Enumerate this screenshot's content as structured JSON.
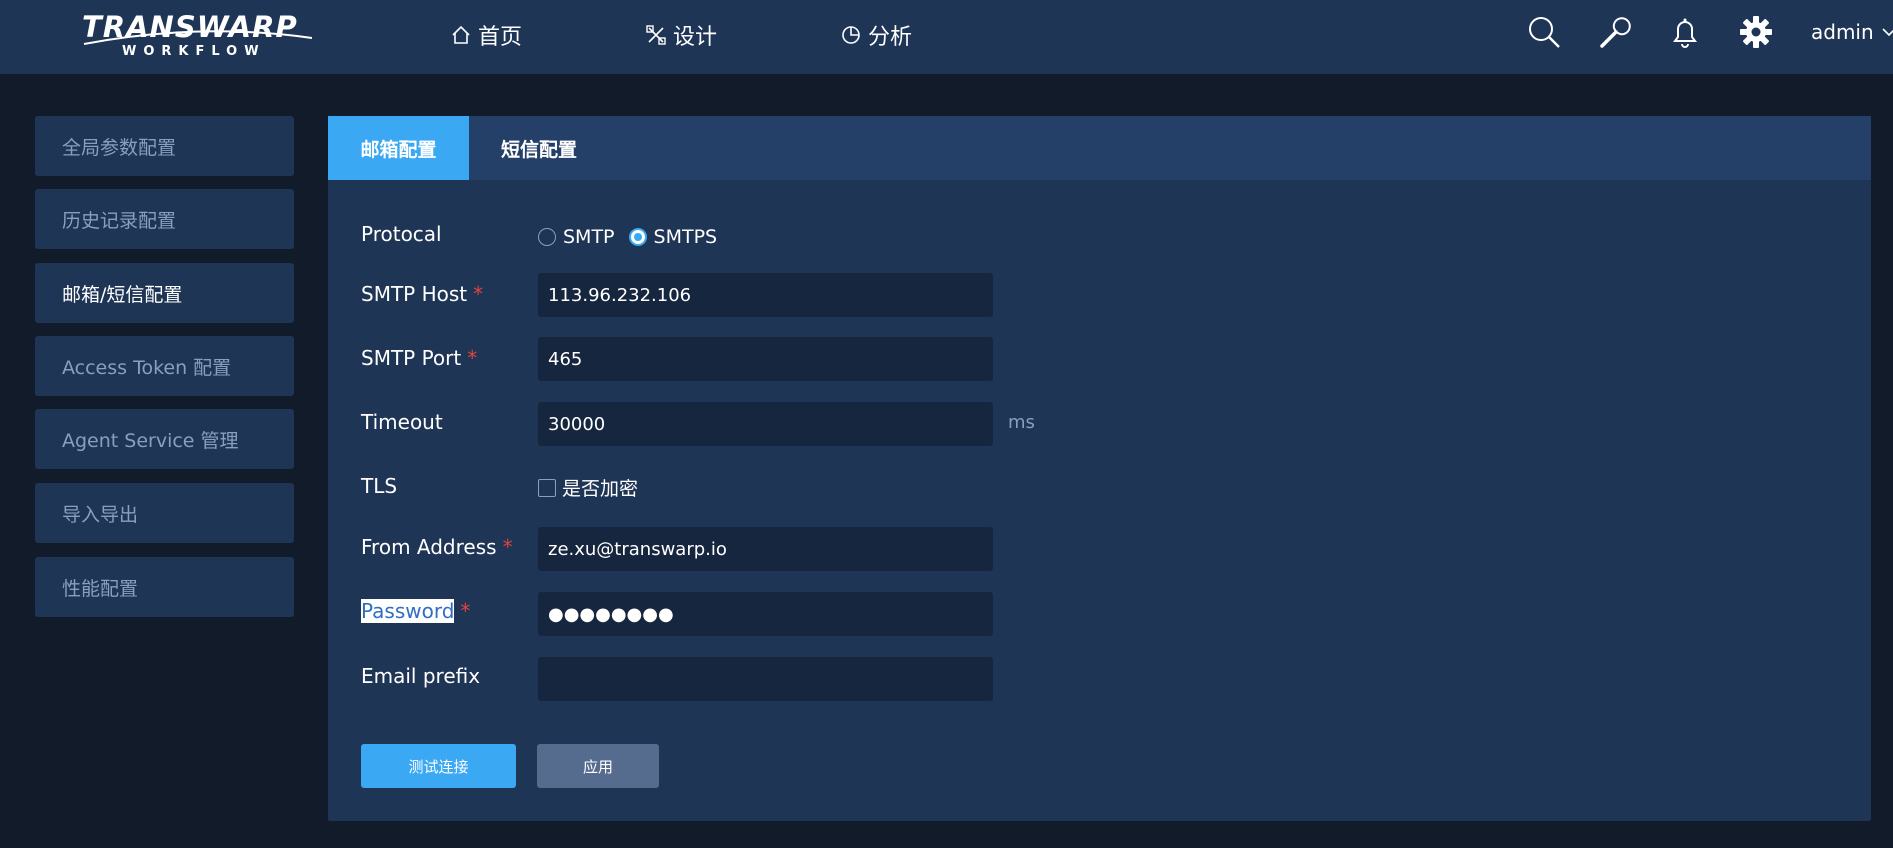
{
  "header": {
    "logo_main": "TRANSWARP",
    "logo_sub": "WORKFLOW",
    "nav": [
      {
        "label": "首页",
        "icon": "home-icon"
      },
      {
        "label": "设计",
        "icon": "design-icon"
      },
      {
        "label": "分析",
        "icon": "pie-chart-icon"
      }
    ],
    "icons": [
      "search-icon",
      "wrench-icon",
      "bell-icon",
      "gear-icon"
    ],
    "user": "admin"
  },
  "sidebar": {
    "items": [
      {
        "label": "全局参数配置"
      },
      {
        "label": "历史记录配置"
      },
      {
        "label": "邮箱/短信配置",
        "active": true
      },
      {
        "label": "Access Token 配置"
      },
      {
        "label": "Agent Service 管理"
      },
      {
        "label": "导入导出"
      },
      {
        "label": "性能配置"
      }
    ]
  },
  "tabs": [
    {
      "label": "邮箱配置",
      "active": true
    },
    {
      "label": "短信配置"
    }
  ],
  "form": {
    "protocol": {
      "label": "Protocal",
      "options": [
        "SMTP",
        "SMTPS"
      ],
      "selected": "SMTPS"
    },
    "smtp_host": {
      "label": "SMTP Host",
      "required_mark": "*",
      "value": "113.96.232.106"
    },
    "smtp_port": {
      "label": "SMTP Port",
      "required_mark": "*",
      "value": "465"
    },
    "timeout": {
      "label": "Timeout",
      "value": "30000",
      "unit": "ms"
    },
    "tls": {
      "label": "TLS",
      "checkbox_label": "是否加密",
      "checked": false
    },
    "from_address": {
      "label": "From Address",
      "required_mark": "*",
      "value": "ze.xu@transwarp.io"
    },
    "password": {
      "label": "Password",
      "required_mark": "*",
      "value": "●●●●●●●●"
    },
    "email_prefix": {
      "label": "Email prefix",
      "value": ""
    }
  },
  "buttons": {
    "test_connection": "测试连接",
    "apply": "应用"
  },
  "colors": {
    "accent": "#3aa8f2",
    "nav_bg": "#1f3556",
    "page_bg": "#121b29",
    "required": "#e0443e"
  }
}
